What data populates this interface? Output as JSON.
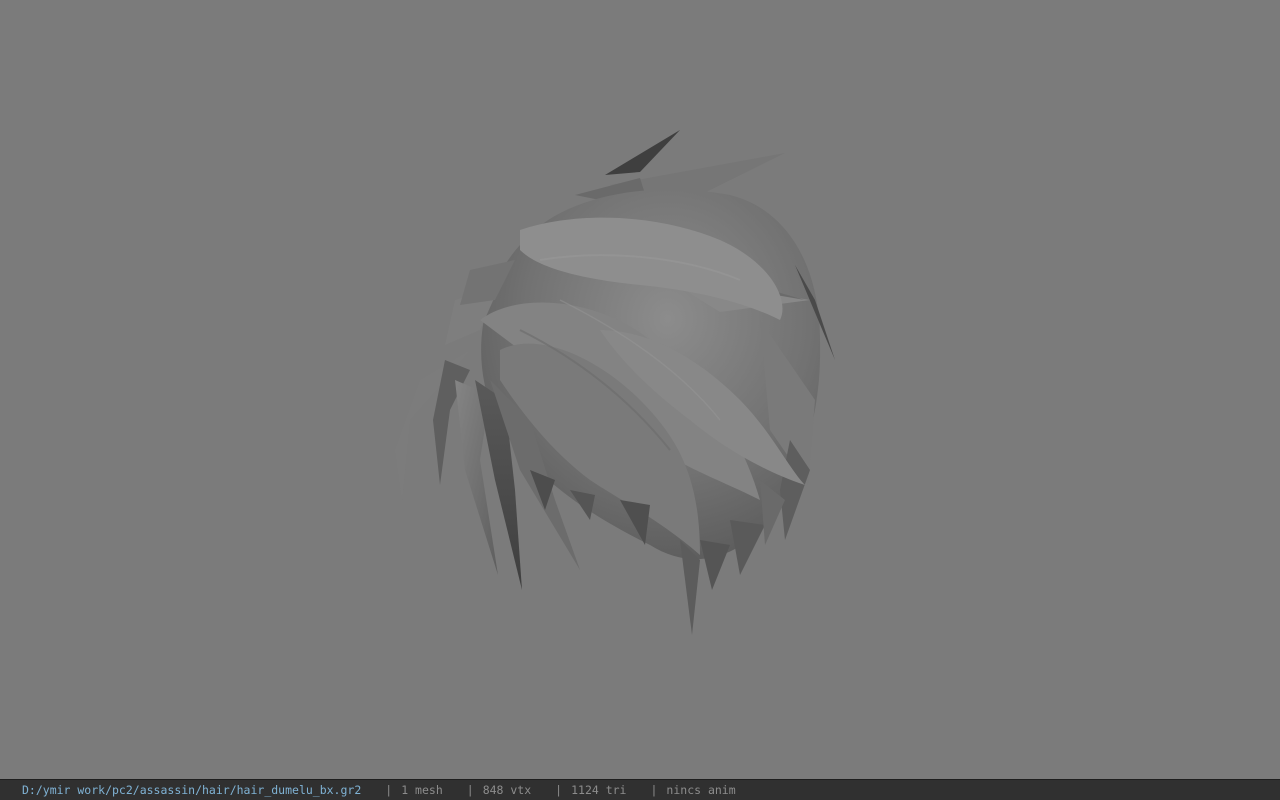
{
  "viewport": {
    "background": "#7b7b7b",
    "model_color": "#6f6f6f",
    "model_shadow": "#4a4a4a",
    "model_highlight": "#8a8a8a"
  },
  "status_bar": {
    "file_path": "D:/ymir work/pc2/assassin/hair/hair_dumelu_bx.gr2",
    "separator": "|",
    "mesh_count": "1 mesh",
    "vertex_count": "848 vtx",
    "triangle_count": "1124 tri",
    "anim_status": "nincs anim",
    "path_color": "#7fb2d4",
    "text_color": "#8c8c8c"
  }
}
